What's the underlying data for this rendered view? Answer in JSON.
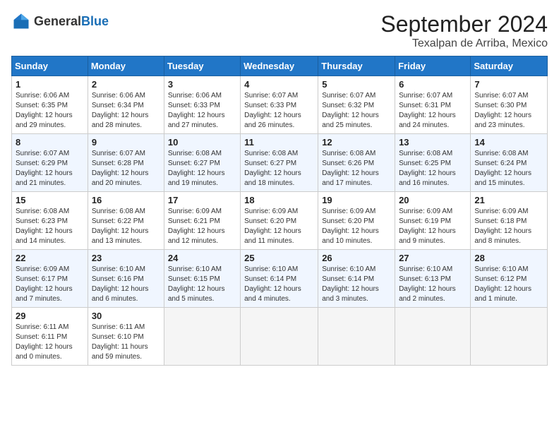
{
  "header": {
    "logo_general": "General",
    "logo_blue": "Blue",
    "month_year": "September 2024",
    "location": "Texalpan de Arriba, Mexico"
  },
  "weekdays": [
    "Sunday",
    "Monday",
    "Tuesday",
    "Wednesday",
    "Thursday",
    "Friday",
    "Saturday"
  ],
  "weeks": [
    [
      {
        "day": "1",
        "lines": [
          "Sunrise: 6:06 AM",
          "Sunset: 6:35 PM",
          "Daylight: 12 hours",
          "and 29 minutes."
        ]
      },
      {
        "day": "2",
        "lines": [
          "Sunrise: 6:06 AM",
          "Sunset: 6:34 PM",
          "Daylight: 12 hours",
          "and 28 minutes."
        ]
      },
      {
        "day": "3",
        "lines": [
          "Sunrise: 6:06 AM",
          "Sunset: 6:33 PM",
          "Daylight: 12 hours",
          "and 27 minutes."
        ]
      },
      {
        "day": "4",
        "lines": [
          "Sunrise: 6:07 AM",
          "Sunset: 6:33 PM",
          "Daylight: 12 hours",
          "and 26 minutes."
        ]
      },
      {
        "day": "5",
        "lines": [
          "Sunrise: 6:07 AM",
          "Sunset: 6:32 PM",
          "Daylight: 12 hours",
          "and 25 minutes."
        ]
      },
      {
        "day": "6",
        "lines": [
          "Sunrise: 6:07 AM",
          "Sunset: 6:31 PM",
          "Daylight: 12 hours",
          "and 24 minutes."
        ]
      },
      {
        "day": "7",
        "lines": [
          "Sunrise: 6:07 AM",
          "Sunset: 6:30 PM",
          "Daylight: 12 hours",
          "and 23 minutes."
        ]
      }
    ],
    [
      {
        "day": "8",
        "lines": [
          "Sunrise: 6:07 AM",
          "Sunset: 6:29 PM",
          "Daylight: 12 hours",
          "and 21 minutes."
        ]
      },
      {
        "day": "9",
        "lines": [
          "Sunrise: 6:07 AM",
          "Sunset: 6:28 PM",
          "Daylight: 12 hours",
          "and 20 minutes."
        ]
      },
      {
        "day": "10",
        "lines": [
          "Sunrise: 6:08 AM",
          "Sunset: 6:27 PM",
          "Daylight: 12 hours",
          "and 19 minutes."
        ]
      },
      {
        "day": "11",
        "lines": [
          "Sunrise: 6:08 AM",
          "Sunset: 6:27 PM",
          "Daylight: 12 hours",
          "and 18 minutes."
        ]
      },
      {
        "day": "12",
        "lines": [
          "Sunrise: 6:08 AM",
          "Sunset: 6:26 PM",
          "Daylight: 12 hours",
          "and 17 minutes."
        ]
      },
      {
        "day": "13",
        "lines": [
          "Sunrise: 6:08 AM",
          "Sunset: 6:25 PM",
          "Daylight: 12 hours",
          "and 16 minutes."
        ]
      },
      {
        "day": "14",
        "lines": [
          "Sunrise: 6:08 AM",
          "Sunset: 6:24 PM",
          "Daylight: 12 hours",
          "and 15 minutes."
        ]
      }
    ],
    [
      {
        "day": "15",
        "lines": [
          "Sunrise: 6:08 AM",
          "Sunset: 6:23 PM",
          "Daylight: 12 hours",
          "and 14 minutes."
        ]
      },
      {
        "day": "16",
        "lines": [
          "Sunrise: 6:08 AM",
          "Sunset: 6:22 PM",
          "Daylight: 12 hours",
          "and 13 minutes."
        ]
      },
      {
        "day": "17",
        "lines": [
          "Sunrise: 6:09 AM",
          "Sunset: 6:21 PM",
          "Daylight: 12 hours",
          "and 12 minutes."
        ]
      },
      {
        "day": "18",
        "lines": [
          "Sunrise: 6:09 AM",
          "Sunset: 6:20 PM",
          "Daylight: 12 hours",
          "and 11 minutes."
        ]
      },
      {
        "day": "19",
        "lines": [
          "Sunrise: 6:09 AM",
          "Sunset: 6:20 PM",
          "Daylight: 12 hours",
          "and 10 minutes."
        ]
      },
      {
        "day": "20",
        "lines": [
          "Sunrise: 6:09 AM",
          "Sunset: 6:19 PM",
          "Daylight: 12 hours",
          "and 9 minutes."
        ]
      },
      {
        "day": "21",
        "lines": [
          "Sunrise: 6:09 AM",
          "Sunset: 6:18 PM",
          "Daylight: 12 hours",
          "and 8 minutes."
        ]
      }
    ],
    [
      {
        "day": "22",
        "lines": [
          "Sunrise: 6:09 AM",
          "Sunset: 6:17 PM",
          "Daylight: 12 hours",
          "and 7 minutes."
        ]
      },
      {
        "day": "23",
        "lines": [
          "Sunrise: 6:10 AM",
          "Sunset: 6:16 PM",
          "Daylight: 12 hours",
          "and 6 minutes."
        ]
      },
      {
        "day": "24",
        "lines": [
          "Sunrise: 6:10 AM",
          "Sunset: 6:15 PM",
          "Daylight: 12 hours",
          "and 5 minutes."
        ]
      },
      {
        "day": "25",
        "lines": [
          "Sunrise: 6:10 AM",
          "Sunset: 6:14 PM",
          "Daylight: 12 hours",
          "and 4 minutes."
        ]
      },
      {
        "day": "26",
        "lines": [
          "Sunrise: 6:10 AM",
          "Sunset: 6:14 PM",
          "Daylight: 12 hours",
          "and 3 minutes."
        ]
      },
      {
        "day": "27",
        "lines": [
          "Sunrise: 6:10 AM",
          "Sunset: 6:13 PM",
          "Daylight: 12 hours",
          "and 2 minutes."
        ]
      },
      {
        "day": "28",
        "lines": [
          "Sunrise: 6:10 AM",
          "Sunset: 6:12 PM",
          "Daylight: 12 hours",
          "and 1 minute."
        ]
      }
    ],
    [
      {
        "day": "29",
        "lines": [
          "Sunrise: 6:11 AM",
          "Sunset: 6:11 PM",
          "Daylight: 12 hours",
          "and 0 minutes."
        ]
      },
      {
        "day": "30",
        "lines": [
          "Sunrise: 6:11 AM",
          "Sunset: 6:10 PM",
          "Daylight: 11 hours",
          "and 59 minutes."
        ]
      },
      {
        "day": "",
        "lines": []
      },
      {
        "day": "",
        "lines": []
      },
      {
        "day": "",
        "lines": []
      },
      {
        "day": "",
        "lines": []
      },
      {
        "day": "",
        "lines": []
      }
    ]
  ]
}
